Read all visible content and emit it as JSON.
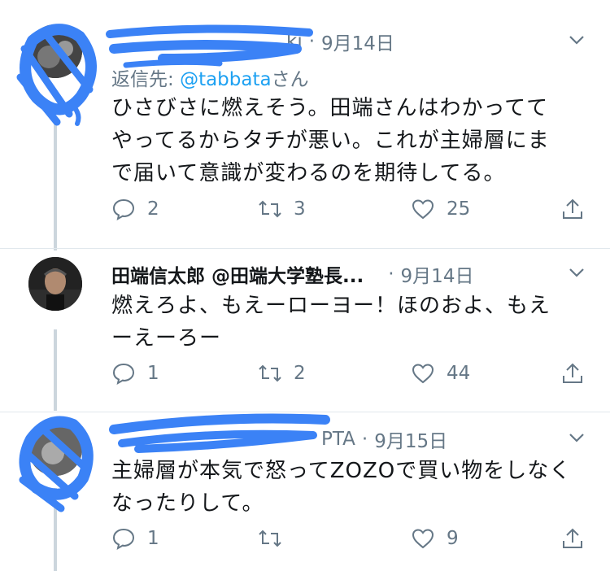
{
  "tweets": [
    {
      "handle": "ki",
      "date": "9月14日",
      "reply_prefix": "返信先: ",
      "reply_mention": "@tabbata",
      "reply_suffix": "さん",
      "text_lines": [
        "ひさびさに燃えそう。田端さんはわかってて",
        "やってるからタチが悪い。これが主婦層にま",
        "で届いて意識が変わるのを期待してる。"
      ],
      "replies": "2",
      "retweets": "3",
      "likes": "25"
    },
    {
      "name": "田端信太郎 @田端大学塾長...",
      "date": "9月14日",
      "text_lines": [
        "燃えろよ、もえーローヨー！ほのおよ、もえ",
        "ーえーろー"
      ],
      "replies": "1",
      "retweets": "2",
      "likes": "44"
    },
    {
      "handle": "PTA",
      "date": "9月15日",
      "text_lines": [
        "主婦層が本気で怒ってZOZOで買い物をしなく",
        "なったりして。"
      ],
      "replies": "1",
      "retweets": "",
      "likes": "9"
    }
  ],
  "separator": "·",
  "colors": {
    "link": "#1da1f2",
    "muted": "#657786",
    "redaction": "#3b82f6"
  }
}
